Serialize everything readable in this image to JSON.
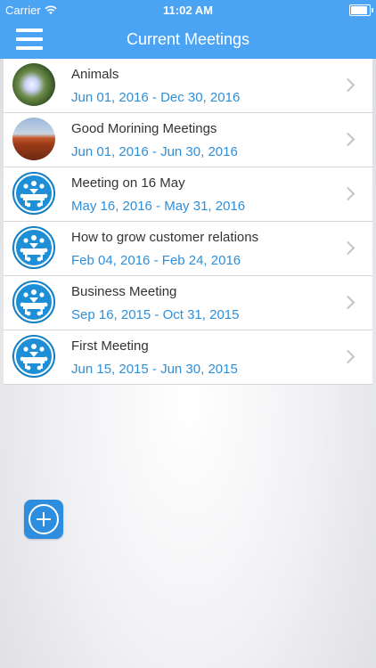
{
  "status_bar": {
    "carrier": "Carrier",
    "time": "11:02 AM"
  },
  "nav": {
    "title": "Current Meetings"
  },
  "meetings": [
    {
      "title": "Animals",
      "dates": "Jun 01, 2016 - Dec 30, 2016",
      "icon": "flower-photo"
    },
    {
      "title": "Good Morining Meetings",
      "dates": "Jun 01, 2016 - Jun 30, 2016",
      "icon": "canyon-photo"
    },
    {
      "title": "Meeting on 16 May",
      "dates": "May 16, 2016 - May 31, 2016",
      "icon": "meeting-icon"
    },
    {
      "title": "How to grow customer relations",
      "dates": "Feb 04, 2016 - Feb 24, 2016",
      "icon": "meeting-icon"
    },
    {
      "title": "Business Meeting",
      "dates": "Sep 16, 2015 - Oct 31, 2015",
      "icon": "meeting-icon"
    },
    {
      "title": "First Meeting",
      "dates": "Jun 15, 2015 - Jun 30, 2015",
      "icon": "meeting-icon"
    }
  ],
  "colors": {
    "accent": "#4aa3f3",
    "date_text": "#2e8fd9",
    "fab": "#2d8ee0"
  }
}
